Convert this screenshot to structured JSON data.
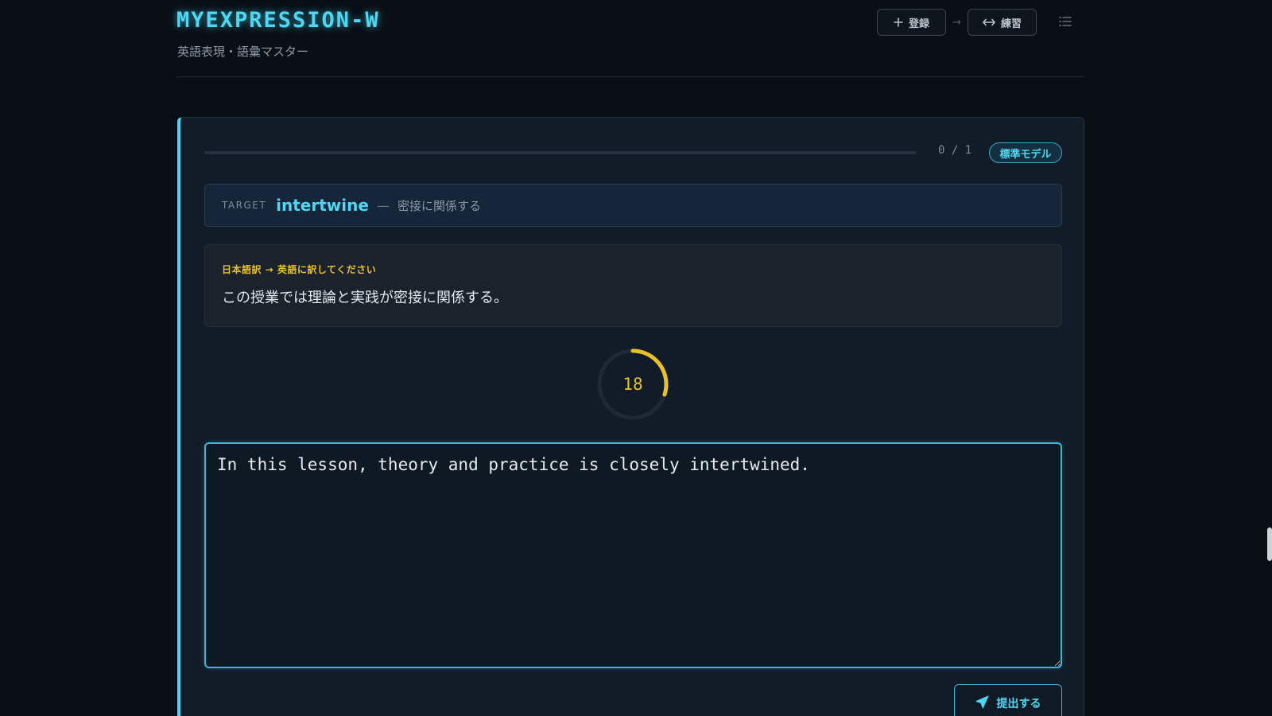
{
  "header": {
    "app_title": "MYEXPRESSION-W",
    "subtitle": "英語表現・語彙マスター",
    "nav": {
      "register_label": "登録",
      "arrow": "→",
      "practice_label": "練習"
    }
  },
  "progress": {
    "current": 0,
    "total": 1,
    "count_text": "0 / 1",
    "fraction": 0
  },
  "model_badge": "標準モデル",
  "target": {
    "label": "TARGET",
    "word": "intertwine",
    "dash": "—",
    "meaning": "密接に関係する"
  },
  "prompt": {
    "label": "日本語訳 → 英語に訳してください",
    "text": "この授業では理論と実践が密接に関係する。"
  },
  "timer": {
    "value": "18",
    "remaining_fraction": 0.3
  },
  "answer": {
    "value": "In this lesson, theory and practice is closely intertwined."
  },
  "submit_label": "提出する",
  "colors": {
    "accent": "#4fd6f0",
    "warning": "#e8c12a",
    "background": "#0a0f16",
    "card": "#121c28"
  },
  "icons": {
    "register": "plus-icon",
    "practice": "swap-arrows-icon",
    "menu": "list-icon",
    "submit": "send-icon"
  }
}
